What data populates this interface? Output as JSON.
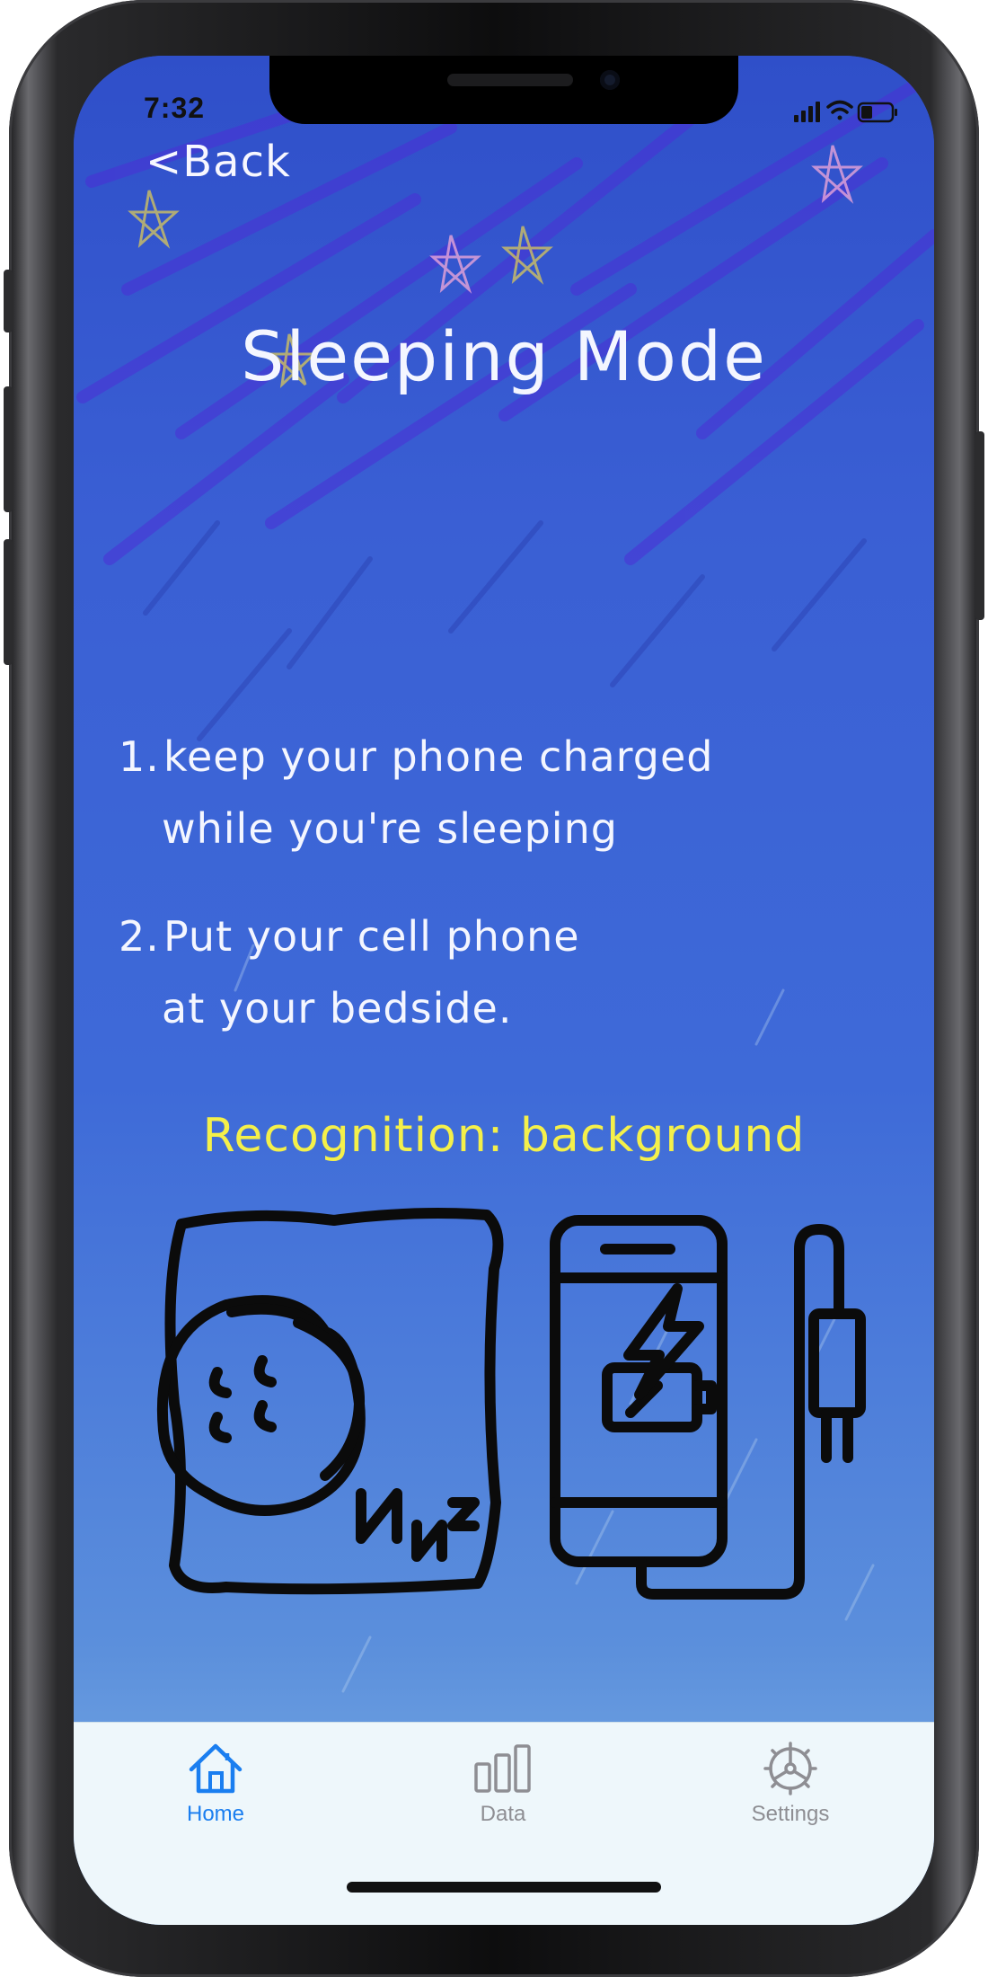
{
  "status_bar": {
    "time": "7:32",
    "icons": [
      "signal-icon",
      "wifi-icon",
      "battery-icon"
    ]
  },
  "nav": {
    "back_label": "<Back"
  },
  "page": {
    "title": "Sleeping Mode",
    "instructions": [
      {
        "number": "1.",
        "line1": "keep your phone charged",
        "line2": "while you're sleeping"
      },
      {
        "number": "2.",
        "line1": "Put your cell phone",
        "line2": "at your bedside."
      }
    ],
    "recognition_text": "Recognition: background",
    "illustration_icons": [
      "sleeping-person-icon",
      "charging-phone-icon"
    ]
  },
  "tab_bar": {
    "tabs": [
      {
        "label": "Home",
        "icon": "home-icon",
        "selected": true
      },
      {
        "label": "Data",
        "icon": "bar-chart-icon",
        "selected": false
      },
      {
        "label": "Settings",
        "icon": "gear-icon",
        "selected": false
      }
    ]
  },
  "colors": {
    "accent": "#1a7ef0",
    "inactive_tab": "#8e8e93",
    "recognition_yellow": "#f4f04a",
    "chalk_white": "#f4f6ff",
    "sky_blue": "#3a68d6"
  }
}
